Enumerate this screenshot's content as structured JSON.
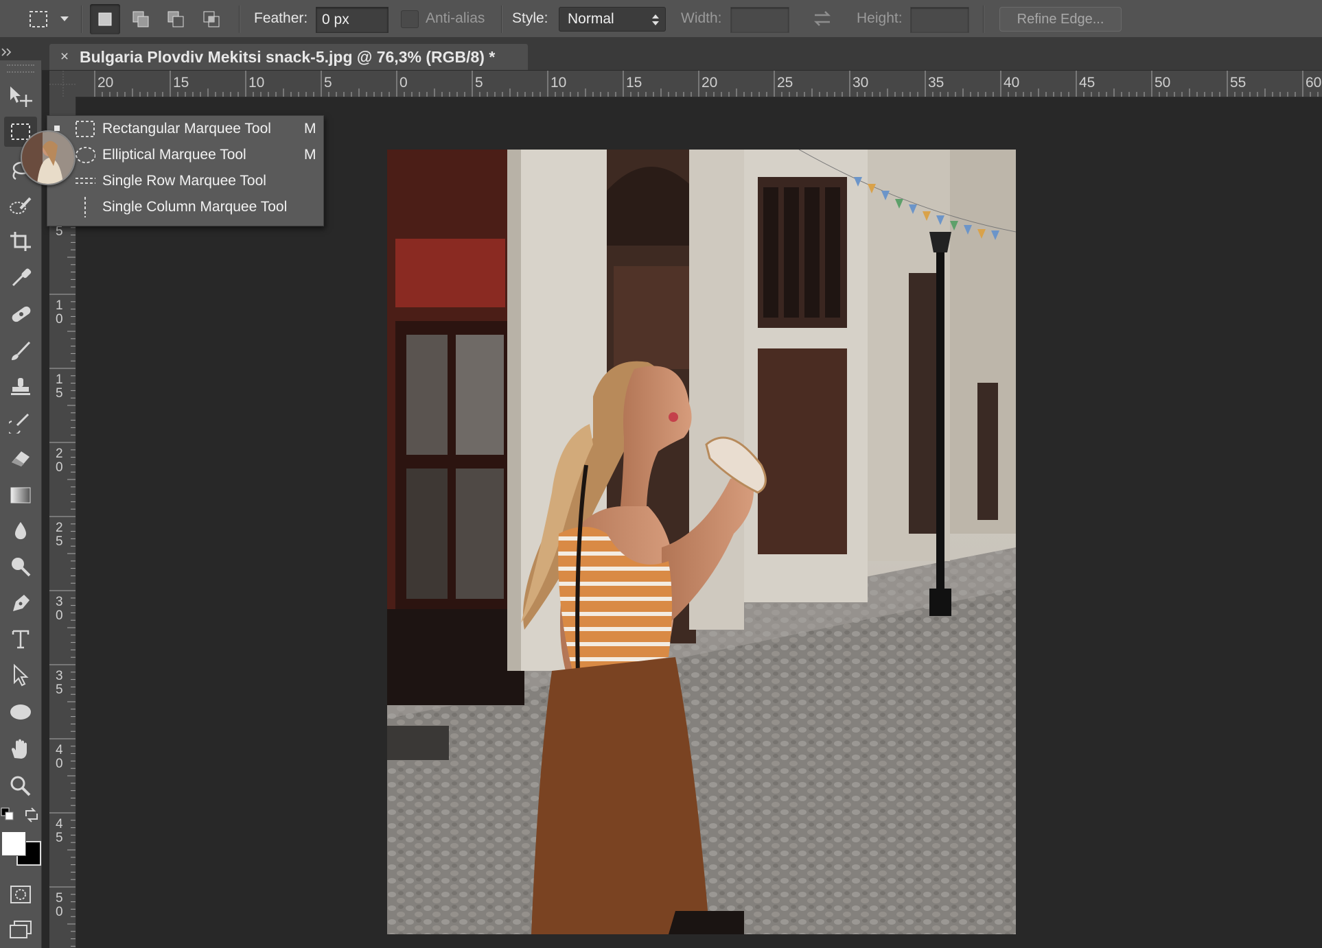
{
  "options_bar": {
    "feather_label": "Feather:",
    "feather_value": "0 px",
    "antialias_label": "Anti-alias",
    "style_label": "Style:",
    "style_value": "Normal",
    "width_label": "Width:",
    "height_label": "Height:",
    "refine_label": "Refine Edge..."
  },
  "document": {
    "tab_title": "Bulgaria Plovdiv Mekitsi snack-5.jpg @ 76,3% (RGB/8) *",
    "close_glyph": "×"
  },
  "ruler": {
    "horizontal": [
      "20",
      "15",
      "10",
      "5",
      "0",
      "5",
      "10",
      "15",
      "20",
      "25",
      "30",
      "35",
      "40",
      "45",
      "50",
      "55",
      "60"
    ],
    "vertical": [
      "5",
      "10",
      "15",
      "20",
      "25",
      "30",
      "35",
      "40",
      "45",
      "50"
    ]
  },
  "flyout": {
    "items": [
      {
        "label": "Rectangular Marquee Tool",
        "shortcut": "M",
        "icon": "rect-marquee-icon"
      },
      {
        "label": "Elliptical Marquee Tool",
        "shortcut": "M",
        "icon": "ellipse-marquee-icon"
      },
      {
        "label": "Single Row Marquee Tool",
        "shortcut": "",
        "icon": "single-row-marquee-icon"
      },
      {
        "label": "Single Column Marquee Tool",
        "shortcut": "",
        "icon": "single-column-marquee-icon"
      }
    ]
  },
  "tools": [
    "move-icon",
    "rect-marquee-icon",
    "lasso-icon",
    "quick-selection-icon",
    "crop-icon",
    "eyedropper-icon",
    "healing-brush-icon",
    "brush-icon",
    "clone-stamp-icon",
    "history-brush-icon",
    "eraser-icon",
    "gradient-icon",
    "blur-icon",
    "dodge-icon",
    "pen-icon",
    "type-icon",
    "path-selection-icon",
    "ellipse-shape-icon",
    "hand-icon",
    "zoom-icon"
  ],
  "colors": {
    "foreground": "#ffffff",
    "background": "#000000",
    "panel": "#535353",
    "workspace": "#282828"
  }
}
